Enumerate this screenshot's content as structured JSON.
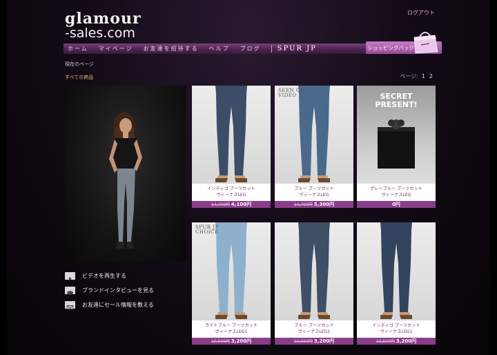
{
  "header": {
    "logo_line1": "glamour",
    "logo_line2": "-sales.com",
    "logout": "ログアウト",
    "cart_label": "ショッピングバッグ"
  },
  "nav": {
    "items": [
      "ホーム",
      "マイページ",
      "お友達を招待する",
      "ヘルプ",
      "ブログ"
    ],
    "spur": "SPUR JP"
  },
  "breadcrumb": "現在のページ",
  "category": "すべての商品",
  "pager": {
    "label": "ページ:",
    "pages": [
      "1",
      "2"
    ]
  },
  "links": [
    {
      "icon": "play-icon",
      "text": "ビデオを再生する"
    },
    {
      "icon": "speech-bubble-icon",
      "text": "ブランドインタビューを見る"
    },
    {
      "icon": "envelope-icon",
      "text": "お友達にセール情報を教える"
    }
  ],
  "products": [
    {
      "badge": "",
      "line1": "インディゴ ブーツカット",
      "line2": "ヴィーナスLEG",
      "old_price": "14,700円",
      "price": "4,100円",
      "jean_color": "#3c4d68"
    },
    {
      "badge": "SEEN ON\nVIDEO",
      "line1": "ブルー ブーツカット",
      "line2": "ヴィーナスLEG",
      "old_price": "14,700円",
      "price": "5,300円",
      "jean_color": "#4a6a8c"
    },
    {
      "badge": "",
      "line1": "グレーブルー ブーツカット",
      "line2": "ヴィーナスLEG",
      "old_price": "",
      "price": "0円",
      "secret": "SECRET\nPRESENT!"
    },
    {
      "badge": "SPUR JP\nCHOICE",
      "line1": "ライトブルー ブーツカット",
      "line2": "ヴィーナスLEG1",
      "old_price": "10,500円",
      "price": "3,200円",
      "jean_color": "#8fb0cc"
    },
    {
      "badge": "",
      "line1": "ブルー ブーツカット",
      "line2": "ヴィーナスLEG1",
      "old_price": "10,500円",
      "price": "3,200円",
      "jean_color": "#3e4f66"
    },
    {
      "badge": "",
      "line1": "インディゴ ブーツカット",
      "line2": "ヴィーナスLEG1",
      "old_price": "10,500円",
      "price": "3,200円",
      "jean_color": "#33445e"
    }
  ]
}
